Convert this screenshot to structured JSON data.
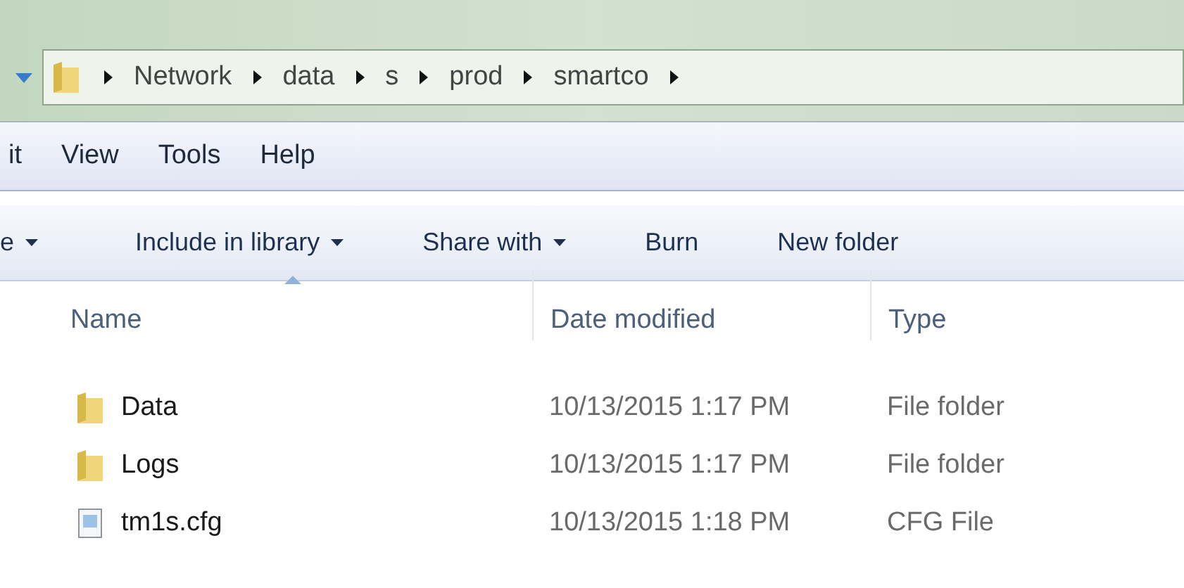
{
  "address_bar": {
    "segments": [
      "Network",
      "data",
      "s",
      "prod",
      "smartco"
    ]
  },
  "menu_bar": {
    "items": [
      "it",
      "View",
      "Tools",
      "Help"
    ]
  },
  "toolbar": {
    "buttons": [
      {
        "label": "e",
        "dropdown": true
      },
      {
        "label": "Include in library",
        "dropdown": true
      },
      {
        "label": "Share with",
        "dropdown": true
      },
      {
        "label": "Burn",
        "dropdown": false
      },
      {
        "label": "New folder",
        "dropdown": false
      }
    ]
  },
  "file_list": {
    "columns": [
      {
        "label": "Name",
        "sorted": true
      },
      {
        "label": "Date modified",
        "sorted": false
      },
      {
        "label": "Type",
        "sorted": false
      }
    ],
    "rows": [
      {
        "kind": "folder",
        "name": "Data",
        "date_modified": "10/13/2015 1:17 PM",
        "type": "File folder"
      },
      {
        "kind": "folder",
        "name": "Logs",
        "date_modified": "10/13/2015 1:17 PM",
        "type": "File folder"
      },
      {
        "kind": "file",
        "name": "tm1s.cfg",
        "date_modified": "10/13/2015 1:18 PM",
        "type": "CFG File"
      }
    ]
  }
}
